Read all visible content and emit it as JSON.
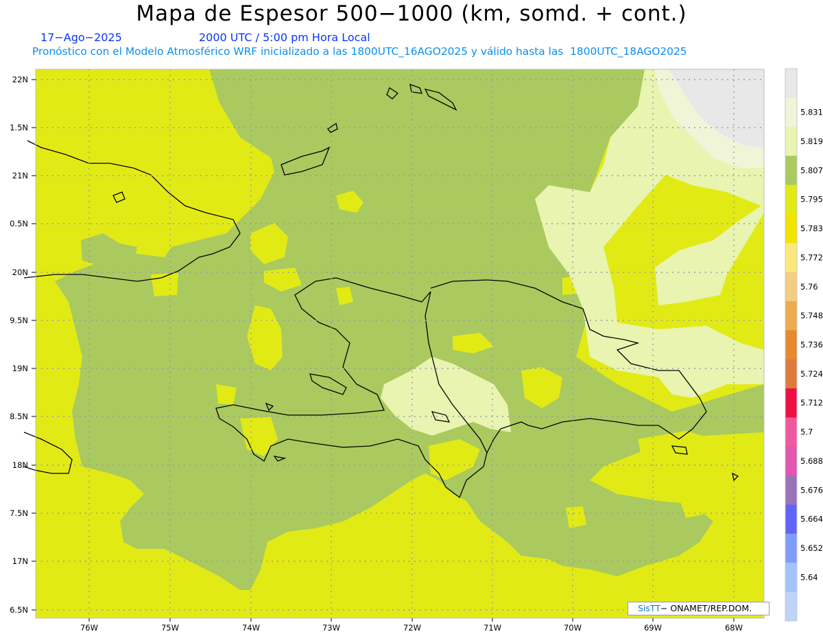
{
  "header": {
    "title": "Mapa de Espesor 500−1000 (km, somd. + cont.)",
    "date": "17−Ago−2025",
    "time": "2000 UTC / 5:00 pm Hora Local",
    "forecast": "Pronóstico con el Modelo Atmosférico WRF inicializado a las 1800UTC_16AGO2025 y válido hasta las  1800UTC_18AGO2025",
    "text_color": "#0a35ff",
    "forecast_color": "#0a8ff0"
  },
  "axes": {
    "lat_labels": [
      "22N",
      "1.5N",
      "21N",
      "0.5N",
      "20N",
      "9.5N",
      "19N",
      "8.5N",
      "18N",
      "7.5N",
      "17N",
      "6.5N"
    ],
    "lon_labels": [
      "76W",
      "75W",
      "74W",
      "73W",
      "72W",
      "71W",
      "70W",
      "69W",
      "68W"
    ]
  },
  "legend": {
    "levels": [
      {
        "label": "",
        "color": "#e8e8e8"
      },
      {
        "label": "5.831",
        "color": "#f0f5d8"
      },
      {
        "label": "5.819",
        "color": "#e8f4b0"
      },
      {
        "label": "5.807",
        "color": "#aac95f"
      },
      {
        "label": "5.795",
        "color": "#e2ea16"
      },
      {
        "label": "5.783",
        "color": "#f3e400"
      },
      {
        "label": "5.772",
        "color": "#fbe97c"
      },
      {
        "label": "5.76",
        "color": "#f2cd82"
      },
      {
        "label": "5.748",
        "color": "#eeac4e"
      },
      {
        "label": "5.736",
        "color": "#e7892e"
      },
      {
        "label": "5.724",
        "color": "#dd7b3c"
      },
      {
        "label": "5.712",
        "color": "#ee1045"
      },
      {
        "label": "5.7",
        "color": "#f0599f"
      },
      {
        "label": "5.688",
        "color": "#e256b0"
      },
      {
        "label": "5.676",
        "color": "#9a74b8"
      },
      {
        "label": "5.664",
        "color": "#6163f6"
      },
      {
        "label": "5.652",
        "color": "#7f9df8"
      },
      {
        "label": "5.64",
        "color": "#a4c3fb"
      },
      {
        "label": "",
        "color": "#c0d3fb"
      }
    ]
  },
  "footer": {
    "logo": "SisTT",
    "org": "− ONAMET/REP.DOM."
  }
}
